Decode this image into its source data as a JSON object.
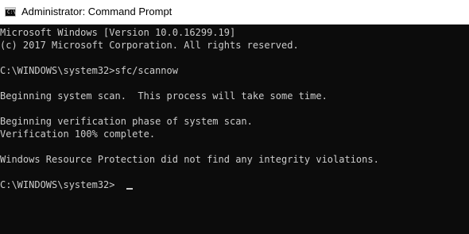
{
  "window": {
    "title": "Administrator: Command Prompt",
    "icon": "cmd-icon",
    "icon_glyph": "C:\\"
  },
  "console": {
    "lines": [
      "Microsoft Windows [Version 10.0.16299.19]",
      "(c) 2017 Microsoft Corporation. All rights reserved.",
      "",
      "C:\\WINDOWS\\system32>sfc/scannow",
      "",
      "Beginning system scan.  This process will take some time.",
      "",
      "Beginning verification phase of system scan.",
      "Verification 100% complete.",
      "",
      "Windows Resource Protection did not find any integrity violations.",
      "",
      "C:\\WINDOWS\\system32>"
    ]
  },
  "colors": {
    "console_background": "#0c0c0c",
    "console_text": "#cccccc",
    "titlebar_background": "#ffffff"
  }
}
